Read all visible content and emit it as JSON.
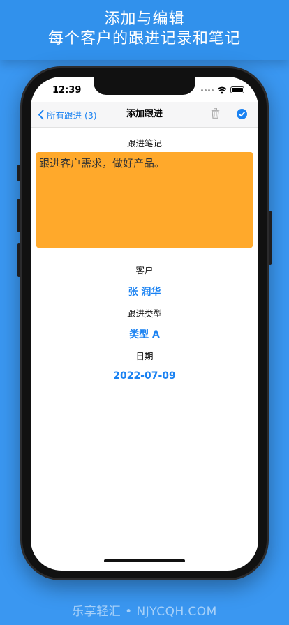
{
  "banner": {
    "line1": "添加与编辑",
    "line2": "每个客户的跟进记录和笔记"
  },
  "status_bar": {
    "time": "12:39"
  },
  "nav": {
    "back_label": "所有跟进 (3)",
    "title": "添加跟进",
    "trash_icon": "trash-icon",
    "done_icon": "checkmark-circle-icon"
  },
  "form": {
    "note_label": "跟进笔记",
    "note_text": "跟进客户需求，做好产品。",
    "customer_label": "客户",
    "customer_value": "张 润华",
    "type_label": "跟进类型",
    "type_value": "类型 A",
    "date_label": "日期",
    "date_value": "2022-07-09"
  },
  "colors": {
    "background": "#3a97f1",
    "accent": "#1a82f2",
    "note_background": "#ffa92b"
  },
  "watermark": "乐享轻汇 • NJYCQH.COM"
}
